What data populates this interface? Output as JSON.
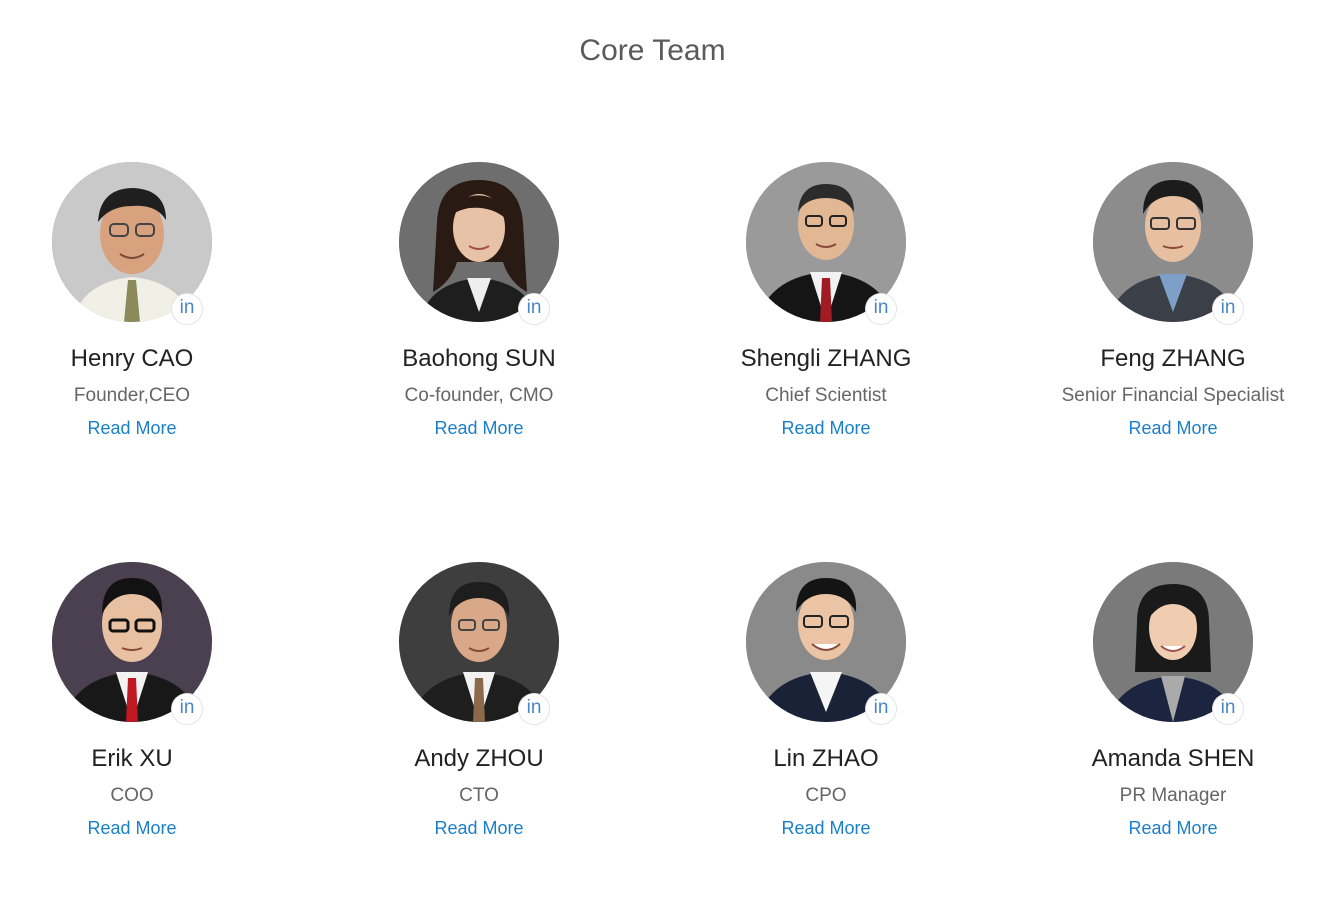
{
  "section": {
    "title": "Core Team"
  },
  "members": [
    {
      "name": "Henry CAO",
      "role": "Founder,CEO",
      "read_more": "Read More",
      "linkedin": "in"
    },
    {
      "name": "Baohong SUN",
      "role": "Co-founder, CMO",
      "read_more": "Read More",
      "linkedin": "in"
    },
    {
      "name": "Shengli ZHANG",
      "role": "Chief Scientist",
      "read_more": "Read More",
      "linkedin": "in"
    },
    {
      "name": "Feng ZHANG",
      "role": "Senior Financial Specialist",
      "read_more": "Read More",
      "linkedin": "in"
    },
    {
      "name": "Erik XU",
      "role": "COO",
      "read_more": "Read More",
      "linkedin": "in"
    },
    {
      "name": "Andy ZHOU",
      "role": "CTO",
      "read_more": "Read More",
      "linkedin": "in"
    },
    {
      "name": "Lin ZHAO",
      "role": "CPO",
      "read_more": "Read More",
      "linkedin": "in"
    },
    {
      "name": "Amanda SHEN",
      "role": "PR Manager",
      "read_more": "Read More",
      "linkedin": "in"
    }
  ],
  "colors": {
    "title": "#5a5a5a",
    "name": "#222222",
    "role": "#666666",
    "link": "#1a7fc9",
    "linkedin_icon": "#4a86c5"
  }
}
